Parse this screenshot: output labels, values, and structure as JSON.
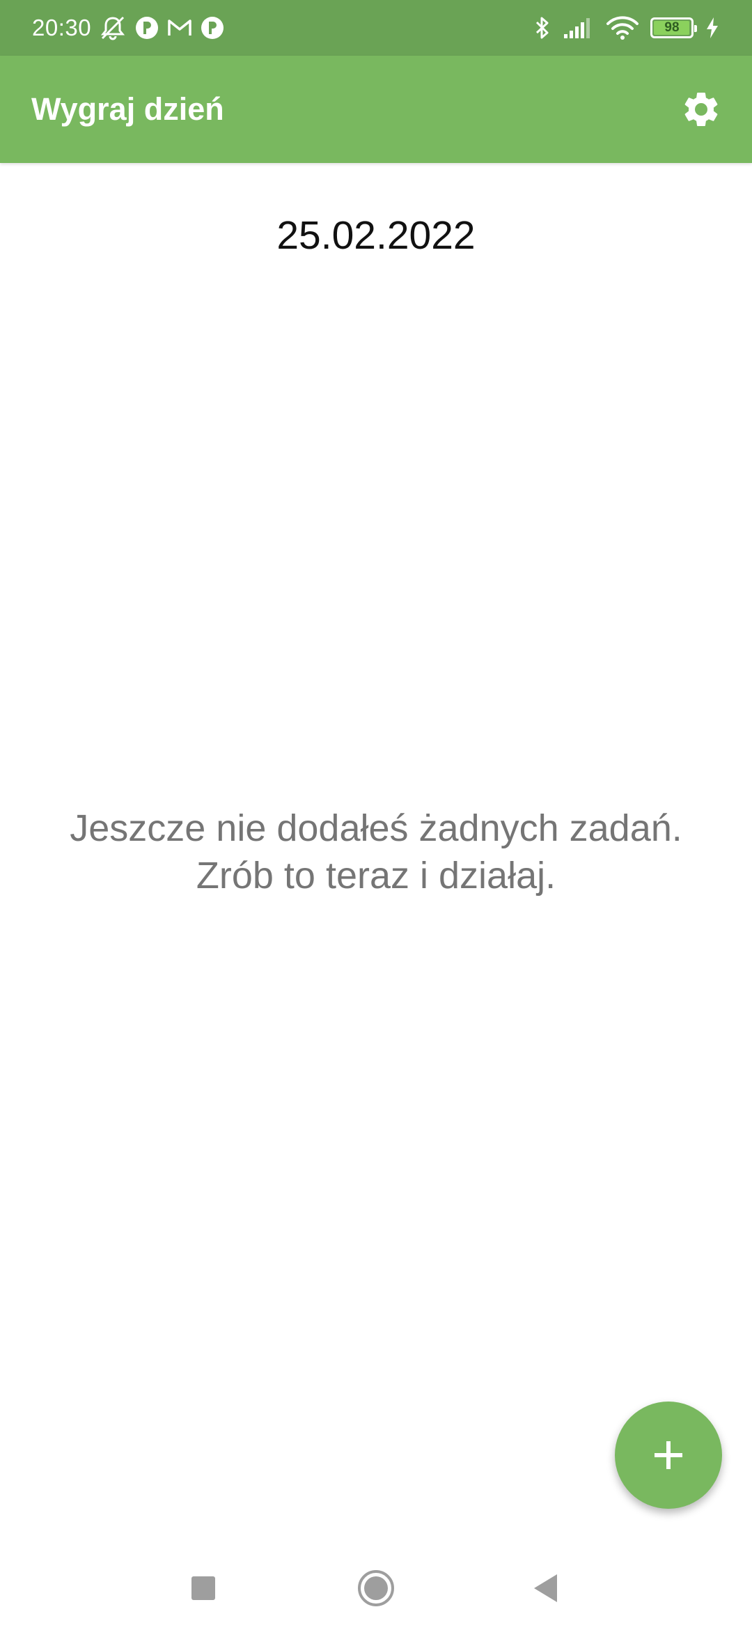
{
  "status_bar": {
    "time": "20:30",
    "battery_level": "98",
    "battery_fraction": 0.98,
    "icons": [
      "muted-bell-icon",
      "app-notification-icon",
      "gmail-icon",
      "app-notification-icon",
      "bluetooth-icon",
      "signal-icon",
      "wifi-icon",
      "battery-icon",
      "charging-icon"
    ]
  },
  "app_bar": {
    "title": "Wygraj dzień",
    "settings_icon": "gear-icon"
  },
  "main": {
    "date": "25.02.2022",
    "empty_line_1": "Jeszcze nie dodałeś żadnych zadań.",
    "empty_line_2": "Zrób to teraz i działaj."
  },
  "fab": {
    "icon": "plus-icon"
  },
  "nav": {
    "buttons": [
      "recents-square-icon",
      "home-circle-icon",
      "back-triangle-icon"
    ]
  },
  "colors": {
    "status_bar": "#6aa355",
    "app_bar": "#79b85f",
    "fab": "#79b85f",
    "message_text": "#757575"
  }
}
